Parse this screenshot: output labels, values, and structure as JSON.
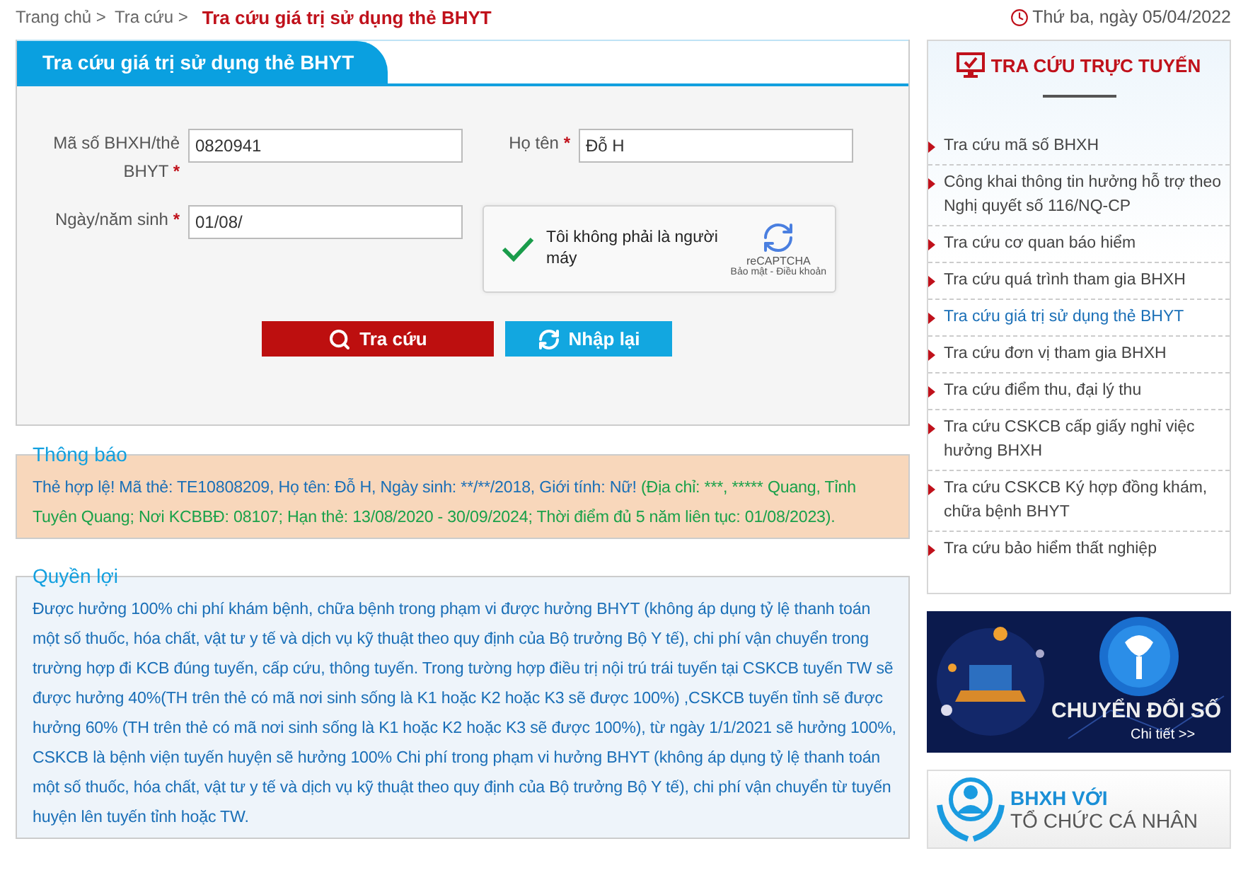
{
  "breadcrumb": {
    "items": [
      "Trang chủ >",
      "Tra cứu >"
    ],
    "current": "Tra cứu giá trị sử dụng thẻ BHYT"
  },
  "date": "Thứ ba, ngày 05/04/2022",
  "form": {
    "title": "Tra cứu giá trị sử dụng thẻ BHYT",
    "fields": [
      {
        "label": "Mã số BHXH/thẻ BHYT",
        "required_mark": "*",
        "value": "0820941"
      },
      {
        "label": "Họ tên",
        "required_mark": "*",
        "value": "Đỗ H"
      },
      {
        "label": "Ngày/năm sinh",
        "required_mark": "*",
        "value": "01/08/"
      }
    ],
    "captcha": {
      "label": "Tôi không phải là người máy",
      "checked": true,
      "brand": "reCAPTCHA",
      "links": "Bảo mật - Điều khoản"
    },
    "buttons": [
      {
        "label": "Tra cứu",
        "kind": "search"
      },
      {
        "label": "Nhập lại",
        "kind": "reset"
      }
    ]
  },
  "notice": {
    "title": "Thông báo",
    "status": "Thẻ hợp lệ! Mã thẻ: TE10808209, Họ tên: Đỗ H, Ngày sinh: **/**/2018, Giới tính: Nữ!",
    "details": "(Địa chỉ: ***, ***** Quang, Tỉnh Tuyên Quang; Nơi KCBBĐ: 08107; Hạn thẻ: 13/08/2020 - 30/09/2024; Thời điểm đủ 5 năm liên tục: 01/08/2023)."
  },
  "benefits": {
    "title": "Quyền lợi",
    "text": "Được hưởng 100% chi phí khám bệnh, chữa bệnh trong phạm vi được hưởng BHYT (không áp dụng tỷ lệ thanh toán một số thuốc, hóa chất, vật tư y tế và dịch vụ kỹ thuật theo quy định của Bộ trưởng Bộ Y tế), chi phí vận chuyển trong trường hợp đi KCB đúng tuyến, cấp cứu, thông tuyến. Trong tường hợp điều trị nội trú trái tuyến tại CSKCB tuyến TW sẽ được hưởng 40%(TH trên thẻ có mã nơi sinh sống là K1 hoặc K2 hoặc K3 sẽ được 100%) ,CSKCB tuyến tỉnh sẽ được hưởng 60% (TH trên thẻ có mã nơi sinh sống là K1 hoặc K2 hoặc K3 sẽ được 100%), từ ngày 1/1/2021 sẽ hưởng 100%, CSKCB là bệnh viện tuyến huyện sẽ hưởng 100% Chi phí trong phạm vi hưởng BHYT (không áp dụng tỷ lệ thanh toán một số thuốc, hóa chất, vật tư y tế và dịch vụ kỹ thuật theo quy định của Bộ trưởng Bộ Y tế), chi phí vận chuyển từ tuyến huyện lên tuyến tỉnh hoặc TW."
  },
  "sidebar": {
    "title": "TRA CỨU TRỰC TUYẾN",
    "items": [
      {
        "label": "Tra cứu mã số BHXH",
        "selected": false
      },
      {
        "label": "Công khai thông tin hưởng hỗ trợ theo Nghị quyết số 116/NQ-CP",
        "selected": false
      },
      {
        "label": "Tra cứu cơ quan báo hiểm",
        "selected": false
      },
      {
        "label": "Tra cứu quá trình tham gia BHXH",
        "selected": false
      },
      {
        "label": "Tra cứu giá trị sử dụng thẻ BHYT",
        "selected": true
      },
      {
        "label": "Tra cứu đơn vị tham gia BHXH",
        "selected": false
      },
      {
        "label": "Tra cứu điểm thu, đại lý thu",
        "selected": false
      },
      {
        "label": "Tra cứu CSKCB cấp giấy nghỉ việc hưởng BHXH",
        "selected": false
      },
      {
        "label": "Tra cứu CSKCB Ký hợp đồng khám, chữa bệnh BHYT",
        "selected": false
      },
      {
        "label": "Tra cứu bảo hiểm thất nghiệp",
        "selected": false
      }
    ]
  },
  "banners": [
    {
      "kind": "digital",
      "title": "CHUYỂN ĐỔI SỐ",
      "link": "Chi tiết >>"
    },
    {
      "kind": "people",
      "line_1": "BHXH VỚI",
      "line_2": "TỔ CHỨC CÁ NHÂN"
    }
  ]
}
